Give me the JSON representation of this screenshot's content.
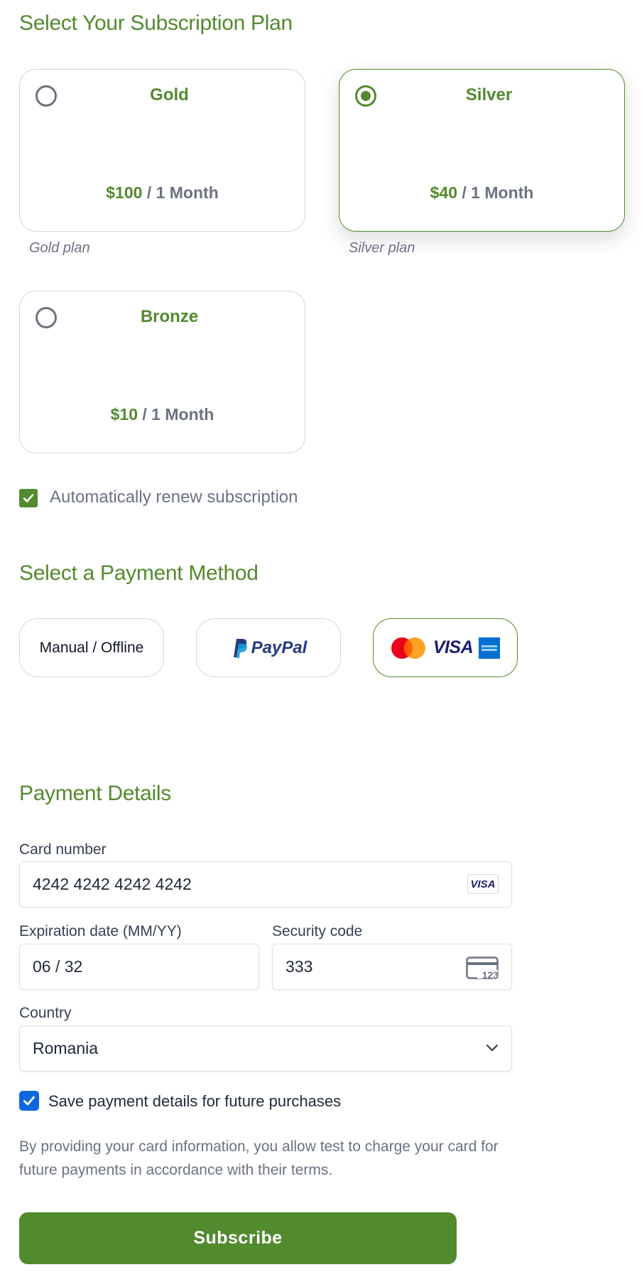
{
  "subscription": {
    "heading": "Select Your Subscription Plan",
    "plans": [
      {
        "name": "Gold",
        "amount": "$100",
        "period": " / 1 Month",
        "description": "Gold plan",
        "selected": false
      },
      {
        "name": "Silver",
        "amount": "$40",
        "period": " / 1 Month",
        "description": "Silver plan",
        "selected": true
      },
      {
        "name": "Bronze",
        "amount": "$10",
        "period": " / 1 Month",
        "description": "",
        "selected": false
      }
    ],
    "auto_renew_label": "Automatically renew subscription",
    "auto_renew_checked": true
  },
  "payment_method": {
    "heading": "Select a Payment Method",
    "options": [
      {
        "label": "Manual / Offline",
        "selected": false
      },
      {
        "label": "PayPal",
        "selected": false
      },
      {
        "label": "VISA",
        "selected": true
      }
    ]
  },
  "payment_details": {
    "heading": "Payment Details",
    "card_number_label": "Card number",
    "card_number_value": "4242 4242 4242 4242",
    "card_brand_badge": "VISA",
    "expiration_label": "Expiration date (MM/YY)",
    "expiration_value": "06 / 32",
    "security_label": "Security code",
    "security_value": "333",
    "security_icon_text": "123",
    "country_label": "Country",
    "country_value": "Romania",
    "save_details_label": "Save payment details for future purchases",
    "save_details_checked": true,
    "terms_text": "By providing your card information, you allow test to charge your card for future payments in accordance with their terms."
  },
  "submit_label": "Subscribe",
  "colors": {
    "brand_green": "#528a2e",
    "checkbox_blue": "#0f67e0",
    "muted_gray": "#6b7280",
    "paypal_dark": "#253b80",
    "paypal_light": "#179bd7",
    "visa_blue": "#1a1f71",
    "mastercard_red": "#eb001b",
    "mastercard_orange": "#f79e1b",
    "amex_blue": "#016fd0"
  }
}
